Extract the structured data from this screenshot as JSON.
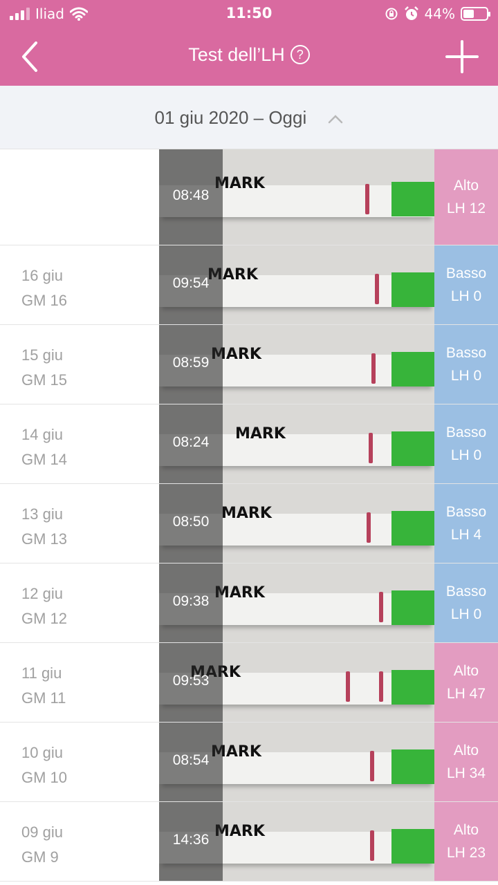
{
  "status_bar": {
    "carrier": "Iliad",
    "time": "11:50",
    "battery": "44%"
  },
  "nav": {
    "title": "Test dell’LH",
    "help_glyph": "?",
    "back_icon": "chevron-left-icon",
    "add_icon": "plus-icon"
  },
  "range": {
    "label": "01 giu 2020 – Oggi",
    "icon": "chevron-up-icon"
  },
  "colors": {
    "accent": "#d96aa0",
    "low": "#9bbfe3",
    "high": "#e39cc1"
  },
  "rows": [
    {
      "day": "",
      "cycle_day": "",
      "time": "08:48",
      "level": "Alto",
      "lh": "LH 12",
      "kind": "high"
    },
    {
      "day": "16 giu",
      "cycle_day": "GM 16",
      "time": "09:54",
      "level": "Basso",
      "lh": "LH 0",
      "kind": "low"
    },
    {
      "day": "15 giu",
      "cycle_day": "GM 15",
      "time": "08:59",
      "level": "Basso",
      "lh": "LH 0",
      "kind": "low"
    },
    {
      "day": "14 giu",
      "cycle_day": "GM 14",
      "time": "08:24",
      "level": "Basso",
      "lh": "LH 0",
      "kind": "low"
    },
    {
      "day": "13 giu",
      "cycle_day": "GM 13",
      "time": "08:50",
      "level": "Basso",
      "lh": "LH 4",
      "kind": "low"
    },
    {
      "day": "12 giu",
      "cycle_day": "GM 12",
      "time": "09:38",
      "level": "Basso",
      "lh": "LH 0",
      "kind": "low"
    },
    {
      "day": "11 giu",
      "cycle_day": "GM 11",
      "time": "09:53",
      "level": "Alto",
      "lh": "LH 47",
      "kind": "high"
    },
    {
      "day": "10 giu",
      "cycle_day": "GM 10",
      "time": "08:54",
      "level": "Alto",
      "lh": "LH 34",
      "kind": "high"
    },
    {
      "day": "09 giu",
      "cycle_day": "GM 9",
      "time": "14:36",
      "level": "Alto",
      "lh": "LH 23",
      "kind": "high"
    }
  ],
  "strip_mark_text": "MARK"
}
